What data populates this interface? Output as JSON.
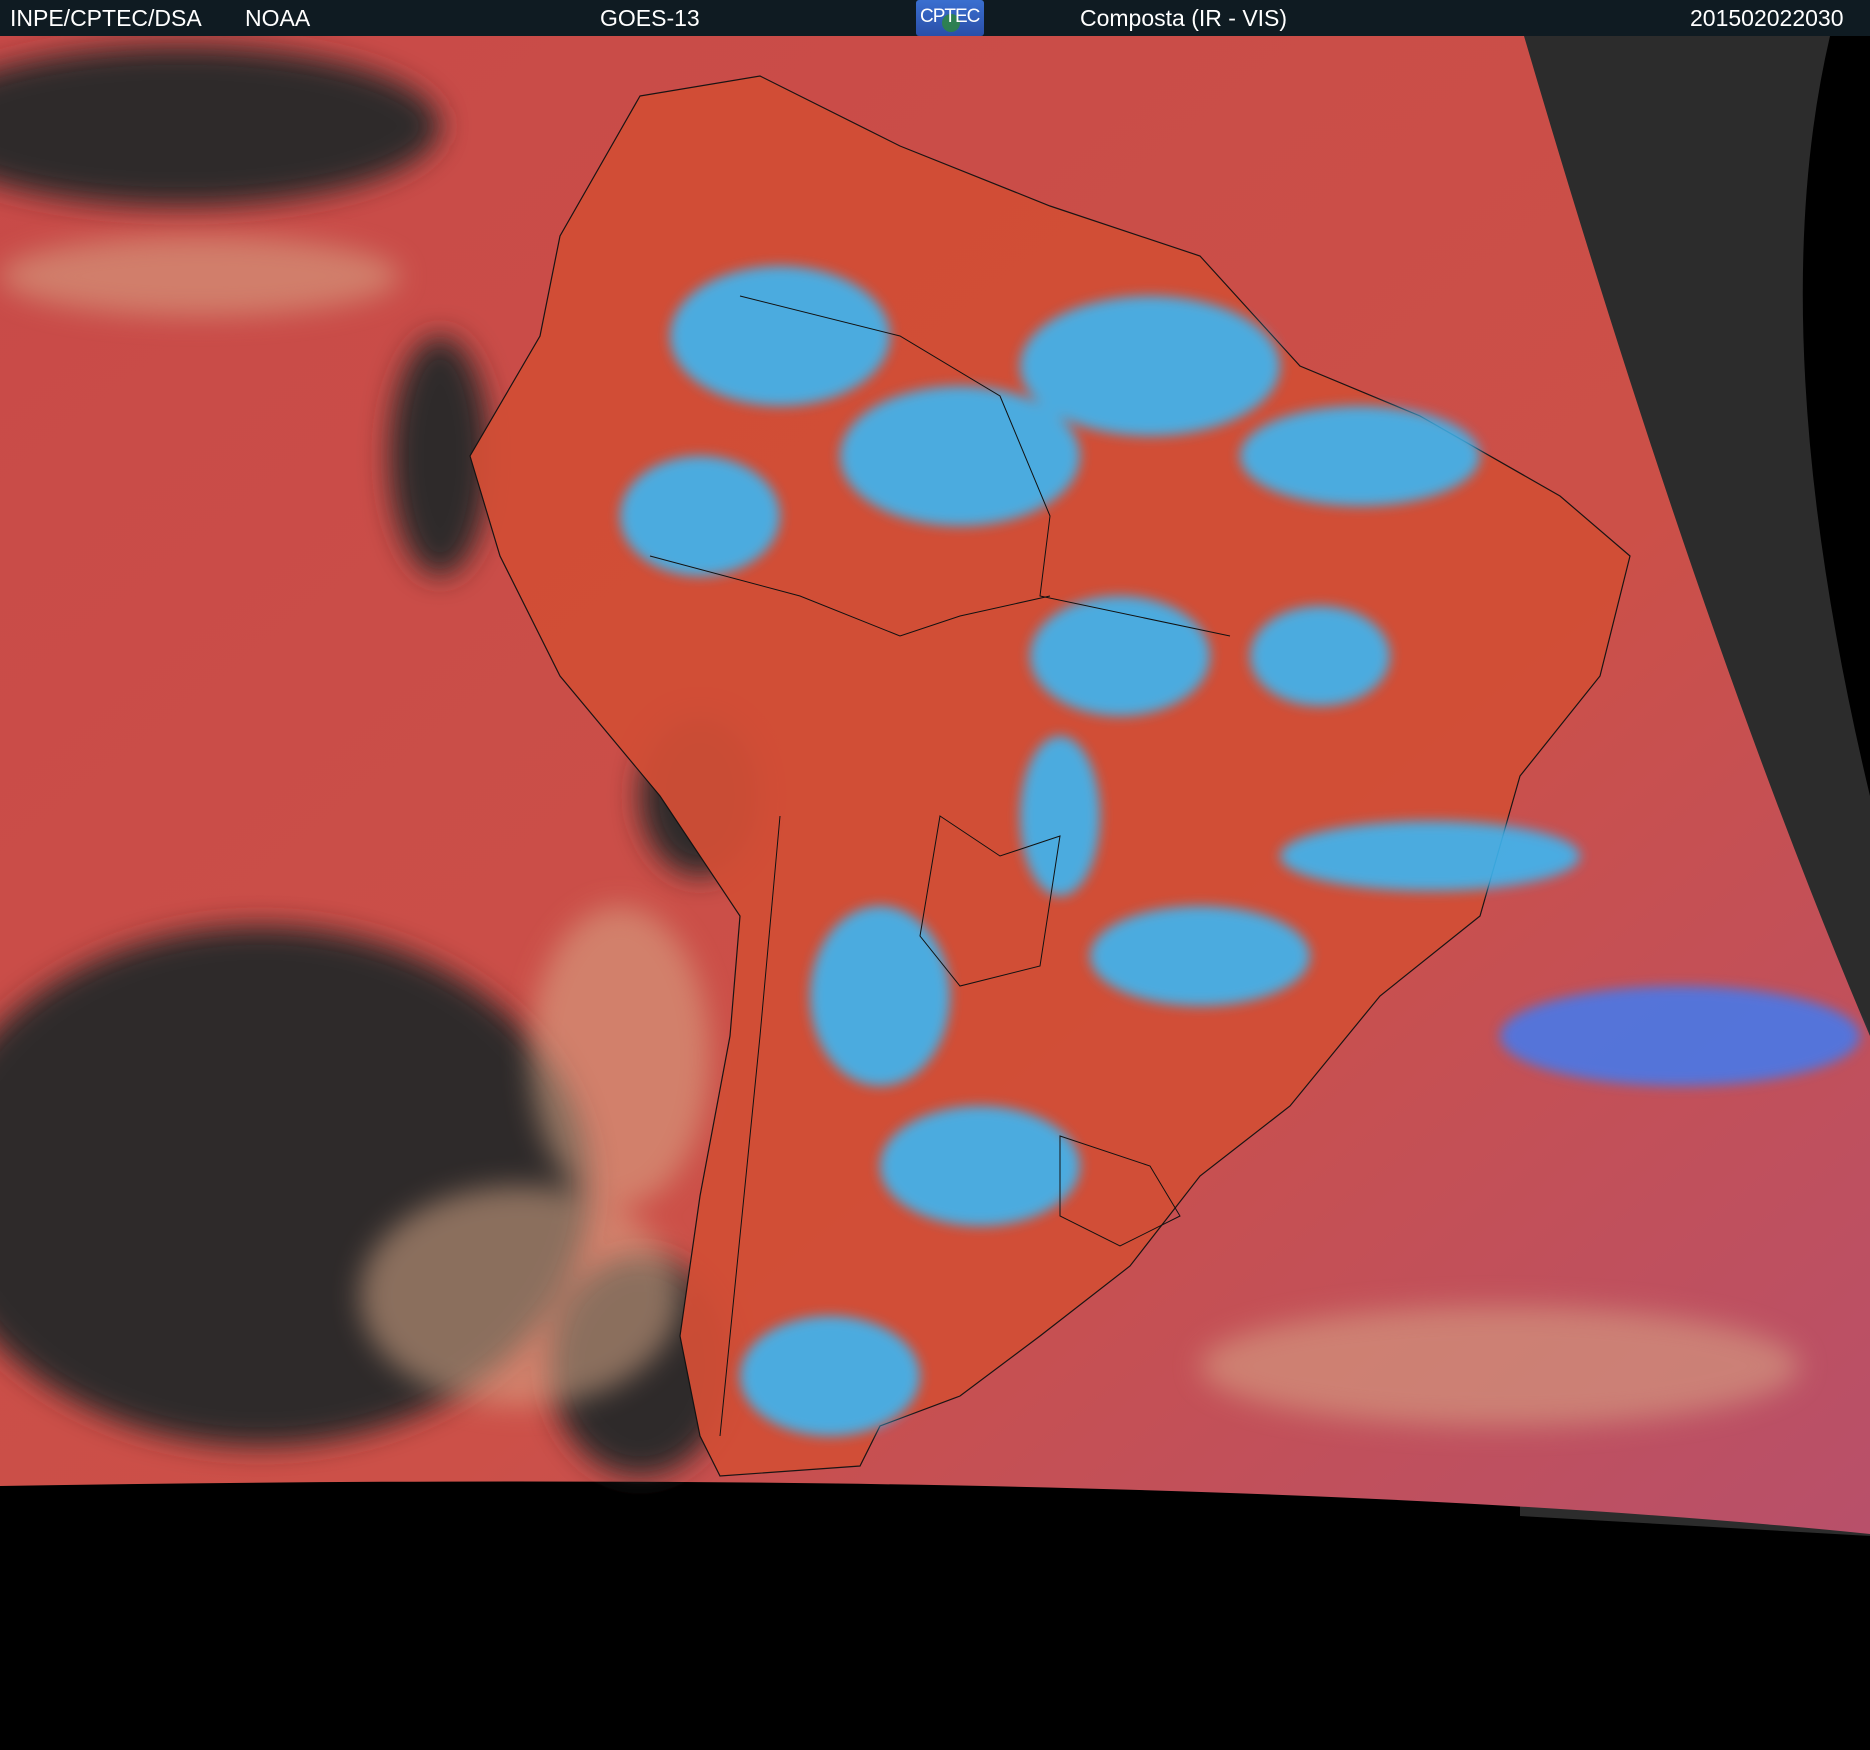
{
  "header": {
    "agency": "INPE/CPTEC/DSA",
    "partner": "NOAA",
    "satellite": "GOES-13",
    "logo_text": "CPTEC",
    "product": "Composta (IR - VIS)",
    "timestamp": "201502022030"
  },
  "colors": {
    "header_bg": "#0f1b22",
    "clear_sky": "#c8504a",
    "land_clear": "#d8502e",
    "cloud_high": "#33b8f0",
    "space": "#000000",
    "dark_ocean": "#2a2a2a"
  }
}
